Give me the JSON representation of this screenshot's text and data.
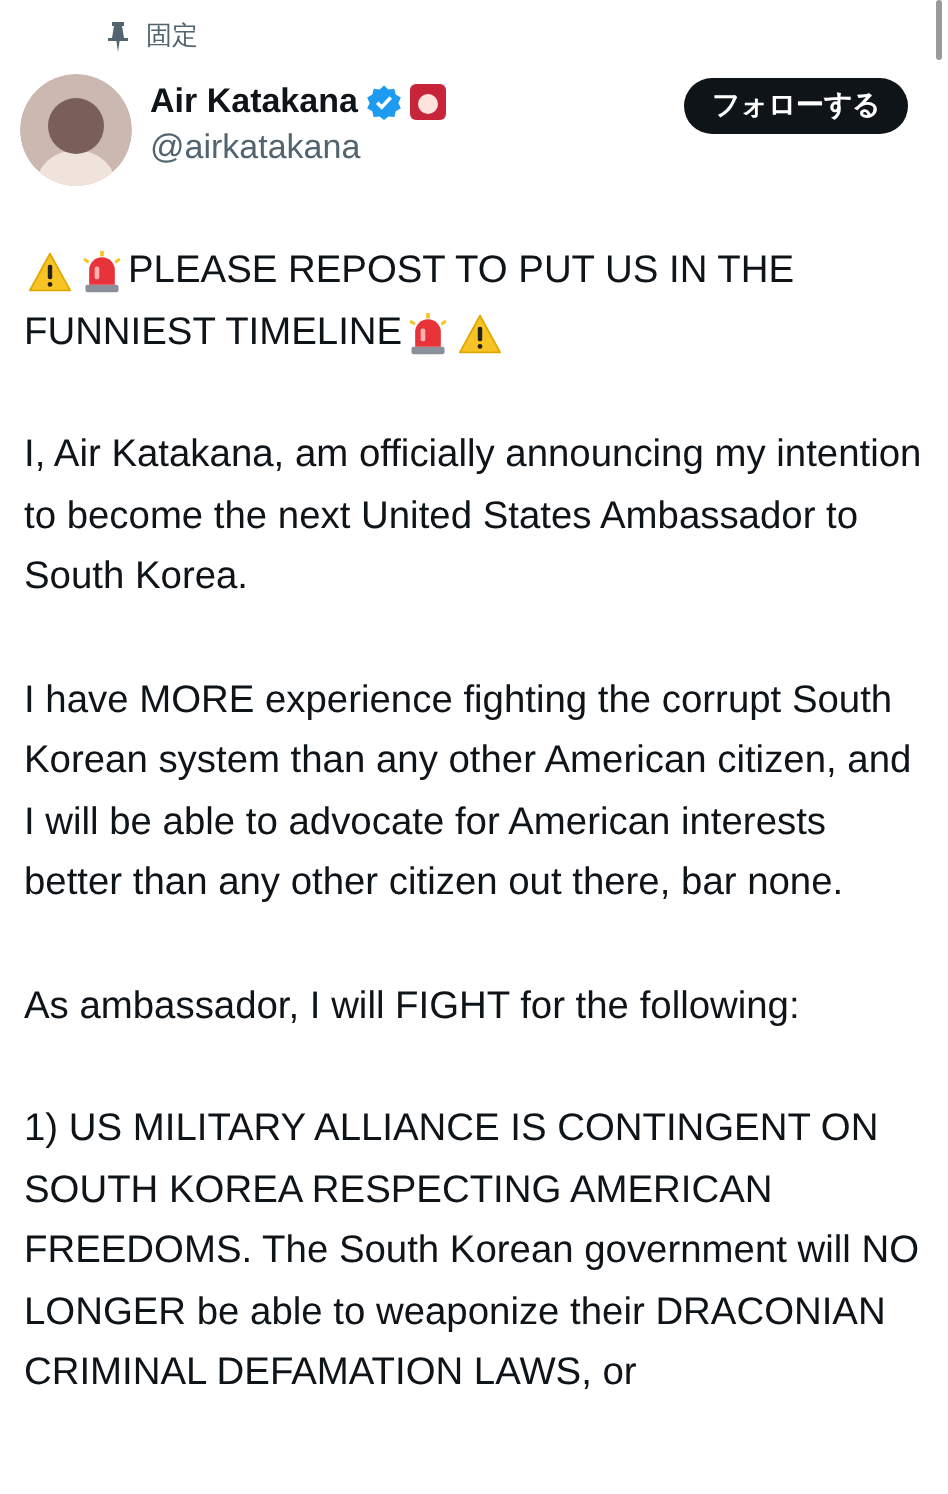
{
  "pinned_label": "固定",
  "author": {
    "name": "Air Katakana",
    "verified": true,
    "handle": "@airkatakana"
  },
  "follow_button": "フォローする",
  "post": {
    "headline_lines": [
      {
        "icons_before": [
          {
            "kind": "warning"
          },
          {
            "kind": "siren"
          }
        ],
        "text": "PLEASE REPOST TO PUT US IN THE"
      },
      {
        "text": "FUNNIEST TIMELINE",
        "icons_after": [
          {
            "kind": "siren"
          },
          {
            "kind": "warning"
          }
        ]
      }
    ],
    "paragraphs": [
      "I, Air Katakana, am officially announcing my intention to become the next United States Ambassador to South Korea.",
      "I have MORE experience fighting the corrupt South Korean system than any other American citizen, and I will be able to advocate for American interests better than any other citizen out there, bar none.",
      "As ambassador, I will FIGHT for the following:",
      "1) US MILITARY ALLIANCE IS CONTINGENT ON SOUTH KOREA RESPECTING AMERICAN FREEDOMS. The South Korean government will NO LONGER be able to weaponize their DRACONIAN CRIMINAL DEFAMATION LAWS, or"
    ]
  }
}
